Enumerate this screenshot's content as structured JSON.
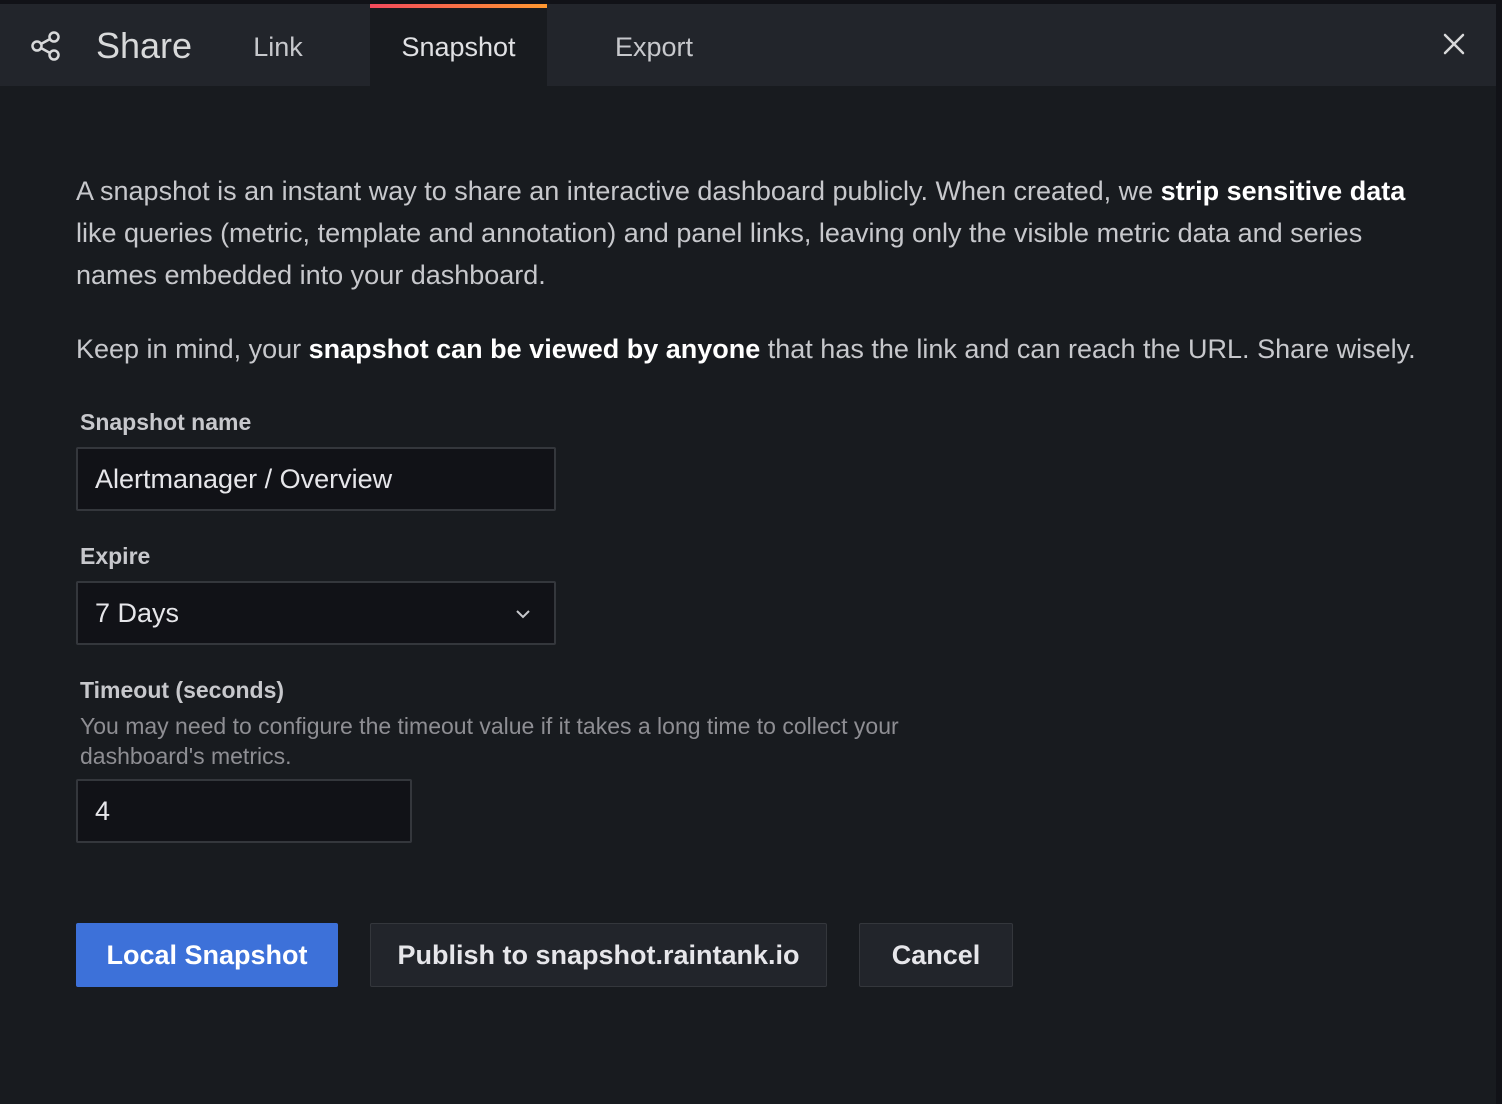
{
  "header": {
    "title": "Share",
    "icon": "share-icon",
    "tabs": [
      {
        "label": "Link",
        "active": false
      },
      {
        "label": "Snapshot",
        "active": true
      },
      {
        "label": "Export",
        "active": false
      }
    ],
    "close_icon": "close-icon"
  },
  "description": {
    "p1_before": "A snapshot is an instant way to share an interactive dashboard publicly. When created, we ",
    "p1_bold": "strip sensitive data",
    "p1_after": " like queries (metric, template and annotation) and panel links, leaving only the visible metric data and series names embedded into your dashboard.",
    "p2_before": "Keep in mind, your ",
    "p2_bold": "snapshot can be viewed by anyone",
    "p2_after": " that has the link and can reach the URL. Share wisely."
  },
  "form": {
    "snapshot_name": {
      "label": "Snapshot name",
      "value": "Alertmanager / Overview"
    },
    "expire": {
      "label": "Expire",
      "value": "7 Days"
    },
    "timeout": {
      "label": "Timeout (seconds)",
      "description": "You may need to configure the timeout value if it takes a long time to collect your dashboard's metrics.",
      "value": "4"
    }
  },
  "buttons": {
    "local_snapshot": "Local Snapshot",
    "publish": "Publish to snapshot.raintank.io",
    "cancel": "Cancel"
  },
  "colors": {
    "background": "#181b1f",
    "header": "#22252b",
    "primary": "#3d71d9",
    "active_tab_gradient_start": "#f2495c",
    "active_tab_gradient_end": "#ff9830"
  }
}
